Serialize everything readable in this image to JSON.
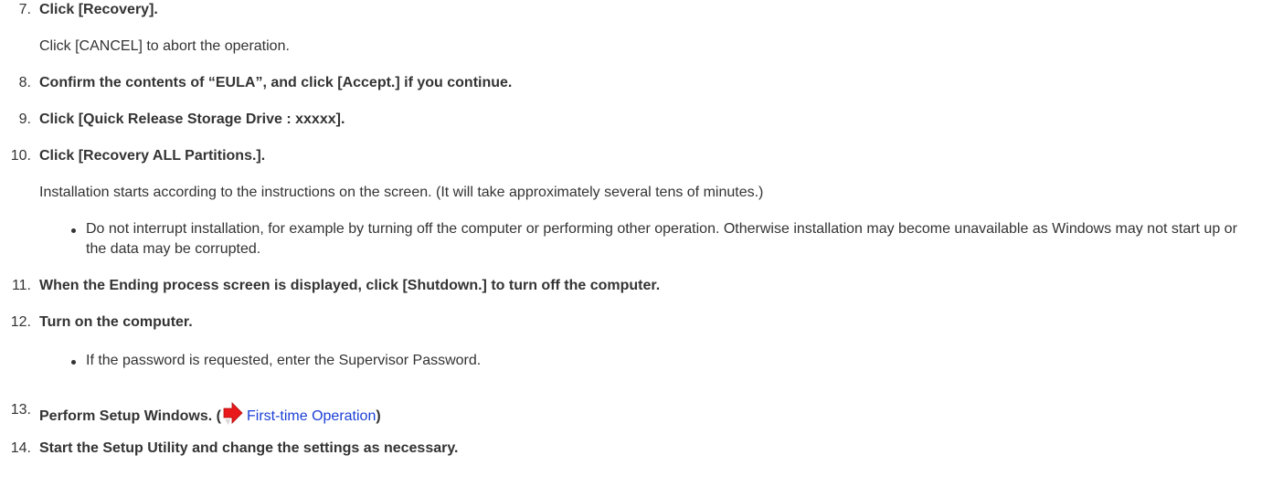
{
  "steps": {
    "s7": {
      "number": "7.",
      "title": "Click [Recovery].",
      "note": "Click [CANCEL] to abort the operation."
    },
    "s8": {
      "number": "8.",
      "title": "Confirm the contents of “EULA”, and click [Accept.] if you continue."
    },
    "s9": {
      "number": "9.",
      "title": "Click [Quick Release Storage Drive : xxxxx]."
    },
    "s10": {
      "number": "10.",
      "title": "Click [Recovery ALL Partitions.].",
      "note": "Installation starts according to the instructions on the screen. (It will take approximately several tens of minutes.)",
      "bullet": "Do not interrupt installation, for example by turning off the computer or performing other operation. Otherwise installation may become unavailable as Windows may not start up or the data may be corrupted."
    },
    "s11": {
      "number": "11.",
      "title": "When the Ending process screen is displayed, click [Shutdown.] to turn off the computer."
    },
    "s12": {
      "number": "12.",
      "title": "Turn on the computer.",
      "bullet": "If the password is requested, enter the Supervisor Password."
    },
    "s13": {
      "number": "13.",
      "title_prefix": "Perform Setup Windows. (",
      "link_text": "First-time Operation",
      "title_suffix": ")",
      "arrow_icon": "red-arrow-right-icon",
      "arrow_color": "#e8181b",
      "link_color": "#1a3fd6"
    },
    "s14": {
      "number": "14.",
      "title": "Start the Setup Utility and change the settings as necessary."
    }
  }
}
